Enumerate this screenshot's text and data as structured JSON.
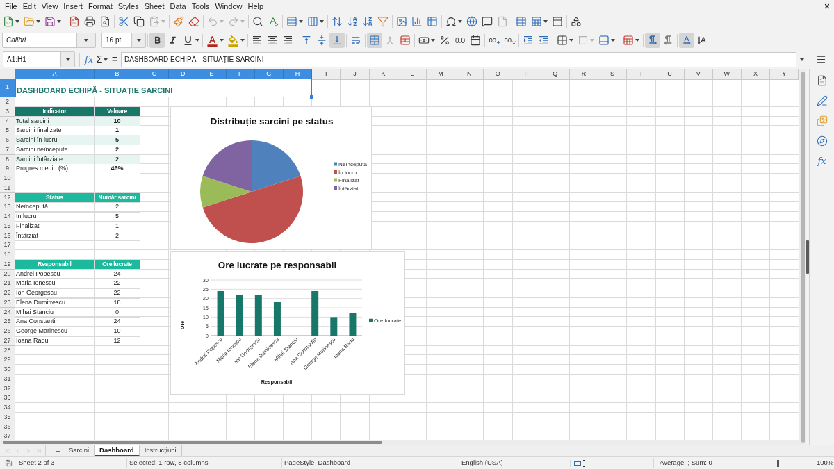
{
  "menu": [
    "File",
    "Edit",
    "View",
    "Insert",
    "Format",
    "Styles",
    "Sheet",
    "Data",
    "Tools",
    "Window",
    "Help"
  ],
  "standard_toolbar": {
    "paste_disabled": true,
    "undo_disabled": true,
    "redo_disabled": true,
    "headers_footers_disabled": true
  },
  "formatting_toolbar": {
    "font_name": "Calibri",
    "font_size": "16 pt",
    "bold": true,
    "italic": false,
    "underline": false,
    "align_left": false,
    "align_center": false,
    "align_right": false,
    "align_top": false,
    "align_middle": false,
    "align_bottom": true,
    "wrap_text": false,
    "merge_center": true,
    "merge_cells_disabled": true,
    "standard_format": "0.0",
    "add_decimal": ".00",
    "delete_decimal": ".00",
    "border_style_disabled": true,
    "left_to_right": true,
    "right_to_left": false,
    "text_horizontal": true,
    "text_vertical": false
  },
  "formula_bar": {
    "name_box": "A1:H1",
    "wizard": "fx",
    "sum": "Σ",
    "equals": "=",
    "content": "DASHBOARD ECHIPĂ - SITUAȚIE SARCINI"
  },
  "sheet": {
    "columns": [
      {
        "label": "A",
        "selected": true
      },
      {
        "label": "B",
        "selected": true
      },
      {
        "label": "C",
        "selected": true
      },
      {
        "label": "D",
        "selected": true
      },
      {
        "label": "E",
        "selected": true
      },
      {
        "label": "F",
        "selected": true
      },
      {
        "label": "G",
        "selected": true
      },
      {
        "label": "H",
        "selected": true
      },
      {
        "label": "I",
        "selected": false
      },
      {
        "label": "J",
        "selected": false
      },
      {
        "label": "K",
        "selected": false
      },
      {
        "label": "L",
        "selected": false
      },
      {
        "label": "M",
        "selected": false
      },
      {
        "label": "N",
        "selected": false
      },
      {
        "label": "O",
        "selected": false
      },
      {
        "label": "P",
        "selected": false
      },
      {
        "label": "Q",
        "selected": false
      },
      {
        "label": "R",
        "selected": false
      },
      {
        "label": "S",
        "selected": false
      },
      {
        "label": "T",
        "selected": false
      },
      {
        "label": "U",
        "selected": false
      },
      {
        "label": "V",
        "selected": false
      },
      {
        "label": "W",
        "selected": false
      },
      {
        "label": "X",
        "selected": false
      },
      {
        "label": "Y",
        "selected": false
      }
    ],
    "rows": [
      {
        "label": "1",
        "selected": true,
        "kind": "title",
        "cells": [
          "DASHBOARD ECHIPĂ - SITUAȚIE SARCINI"
        ]
      },
      {
        "label": "2",
        "selected": false,
        "kind": "blank"
      },
      {
        "label": "3",
        "selected": false,
        "kind": "header",
        "color": "#17786a",
        "cells": [
          "Indicator",
          "Valoare"
        ]
      },
      {
        "label": "4",
        "selected": false,
        "kind": "stat",
        "shaded": true,
        "cells": [
          "Total sarcini",
          "10"
        ]
      },
      {
        "label": "5",
        "selected": false,
        "kind": "stat",
        "shaded": false,
        "cells": [
          "Sarcini finalizate",
          "1"
        ]
      },
      {
        "label": "6",
        "selected": false,
        "kind": "stat",
        "shaded": true,
        "cells": [
          "Sarcini în lucru",
          "5"
        ]
      },
      {
        "label": "7",
        "selected": false,
        "kind": "stat",
        "shaded": false,
        "cells": [
          "Sarcini neîncepute",
          "2"
        ]
      },
      {
        "label": "8",
        "selected": false,
        "kind": "stat",
        "shaded": true,
        "cells": [
          "Sarcini întârziate",
          "2"
        ]
      },
      {
        "label": "9",
        "selected": false,
        "kind": "stat",
        "shaded": false,
        "cells": [
          "Progres mediu (%)",
          "46%"
        ]
      },
      {
        "label": "10",
        "selected": false,
        "kind": "blank"
      },
      {
        "label": "11",
        "selected": false,
        "kind": "blank"
      },
      {
        "label": "12",
        "selected": false,
        "kind": "header",
        "color": "#1db99d",
        "cells": [
          "Status",
          "Număr sarcini"
        ]
      },
      {
        "label": "13",
        "selected": false,
        "kind": "data",
        "cells": [
          "Neîncepută",
          "2"
        ]
      },
      {
        "label": "14",
        "selected": false,
        "kind": "data",
        "cells": [
          "În lucru",
          "5"
        ]
      },
      {
        "label": "15",
        "selected": false,
        "kind": "data",
        "cells": [
          "Finalizat",
          "1"
        ]
      },
      {
        "label": "16",
        "selected": false,
        "kind": "data",
        "cells": [
          "Întârziat",
          "2"
        ]
      },
      {
        "label": "17",
        "selected": false,
        "kind": "blank"
      },
      {
        "label": "18",
        "selected": false,
        "kind": "blank"
      },
      {
        "label": "19",
        "selected": false,
        "kind": "header",
        "color": "#1db99d",
        "cells": [
          "Responsabil",
          "Ore lucrate"
        ]
      },
      {
        "label": "20",
        "selected": false,
        "kind": "data",
        "cells": [
          "Andrei Popescu",
          "24"
        ]
      },
      {
        "label": "21",
        "selected": false,
        "kind": "data",
        "cells": [
          "Maria Ionescu",
          "22"
        ]
      },
      {
        "label": "22",
        "selected": false,
        "kind": "data",
        "cells": [
          "Ion Georgescu",
          "22"
        ]
      },
      {
        "label": "23",
        "selected": false,
        "kind": "data",
        "cells": [
          "Elena Dumitrescu",
          "18"
        ]
      },
      {
        "label": "24",
        "selected": false,
        "kind": "data",
        "cells": [
          "Mihai Stanciu",
          "0"
        ]
      },
      {
        "label": "25",
        "selected": false,
        "kind": "data",
        "cells": [
          "Ana Constantin",
          "24"
        ]
      },
      {
        "label": "26",
        "selected": false,
        "kind": "data",
        "cells": [
          "George Marinescu",
          "10"
        ]
      },
      {
        "label": "27",
        "selected": false,
        "kind": "data",
        "cells": [
          "Ioana Radu",
          "12"
        ]
      },
      {
        "label": "28",
        "selected": false,
        "kind": "blank"
      },
      {
        "label": "29",
        "selected": false,
        "kind": "blank"
      },
      {
        "label": "30",
        "selected": false,
        "kind": "blank"
      },
      {
        "label": "31",
        "selected": false,
        "kind": "blank"
      },
      {
        "label": "32",
        "selected": false,
        "kind": "blank"
      },
      {
        "label": "33",
        "selected": false,
        "kind": "blank"
      },
      {
        "label": "34",
        "selected": false,
        "kind": "blank"
      },
      {
        "label": "35",
        "selected": false,
        "kind": "blank"
      },
      {
        "label": "36",
        "selected": false,
        "kind": "blank"
      },
      {
        "label": "37",
        "selected": false,
        "kind": "blank"
      }
    ]
  },
  "charts": [
    {
      "chart_data": {
        "type": "pie",
        "title": "Distribuție sarcini pe status",
        "categories": [
          "Neîncepută",
          "În lucru",
          "Finalizat",
          "Întârziat"
        ],
        "values": [
          20,
          50,
          10,
          20
        ],
        "colors": [
          "#4f81bd",
          "#c0504d",
          "#9bbb59",
          "#8064a2"
        ],
        "legend": "right"
      }
    },
    {
      "chart_data": {
        "type": "bar",
        "title": "Ore lucrate pe responsabil",
        "xlabel": "Responsabil",
        "ylabel": "Ore",
        "categories": [
          "Andrei Popescu",
          "Maria Ionescu",
          "Ion Georgescu",
          "Elena Dumitrescu",
          "Mihai Stanciu",
          "Ana Constantin",
          "George Marinescu",
          "Ioana Radu"
        ],
        "series": [
          {
            "name": "Ore lucrate",
            "color": "#17786a",
            "values": [
              24,
              22,
              22,
              18,
              0,
              24,
              10,
              12
            ]
          }
        ],
        "ylim": [
          0,
          30
        ],
        "yticks": [
          0,
          5,
          10,
          15,
          20,
          25,
          30
        ],
        "grid": true,
        "legend": "right"
      }
    }
  ],
  "sidebar": {
    "functions": "fx"
  },
  "sheet_tab_bar": {
    "navigation_disabled": true,
    "tabs": [
      {
        "label": "Sarcini",
        "selected": false
      },
      {
        "label": "Dashboard",
        "selected": true
      },
      {
        "label": "Instrucțiuni",
        "selected": false
      }
    ]
  },
  "status_bar": {
    "sheet": "Sheet 2 of 3",
    "selection": "Selected: 1 row, 8 columns",
    "page_style": "PageStyle_Dashboard",
    "language": "English (USA)",
    "summary": "Average: ; Sum: 0",
    "zoom": {
      "level": 0.5,
      "reading": "100%"
    }
  }
}
